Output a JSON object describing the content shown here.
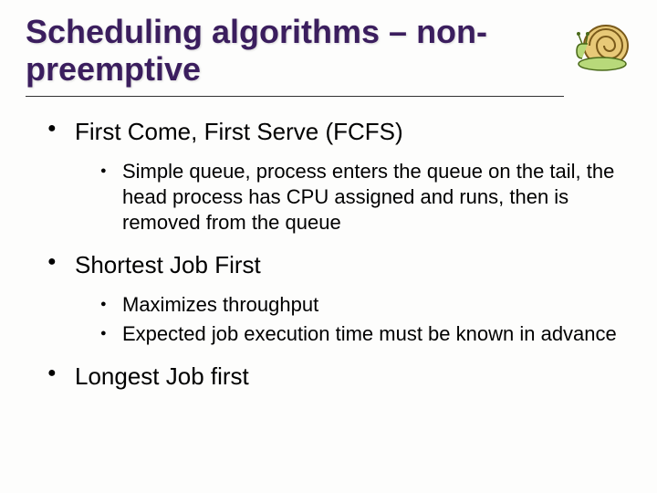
{
  "title": "Scheduling algorithms – non-preemptive",
  "icon": "snail-icon",
  "bullets": [
    {
      "text": "First Come, First Serve (FCFS)",
      "sub": [
        "Simple queue, process enters the queue on the tail, the head process has CPU assigned and runs, then is removed from the queue"
      ]
    },
    {
      "text": "Shortest Job First",
      "sub": [
        "Maximizes throughput",
        "Expected job execution time must be known in advance"
      ]
    },
    {
      "text": "Longest Job first",
      "sub": []
    }
  ]
}
